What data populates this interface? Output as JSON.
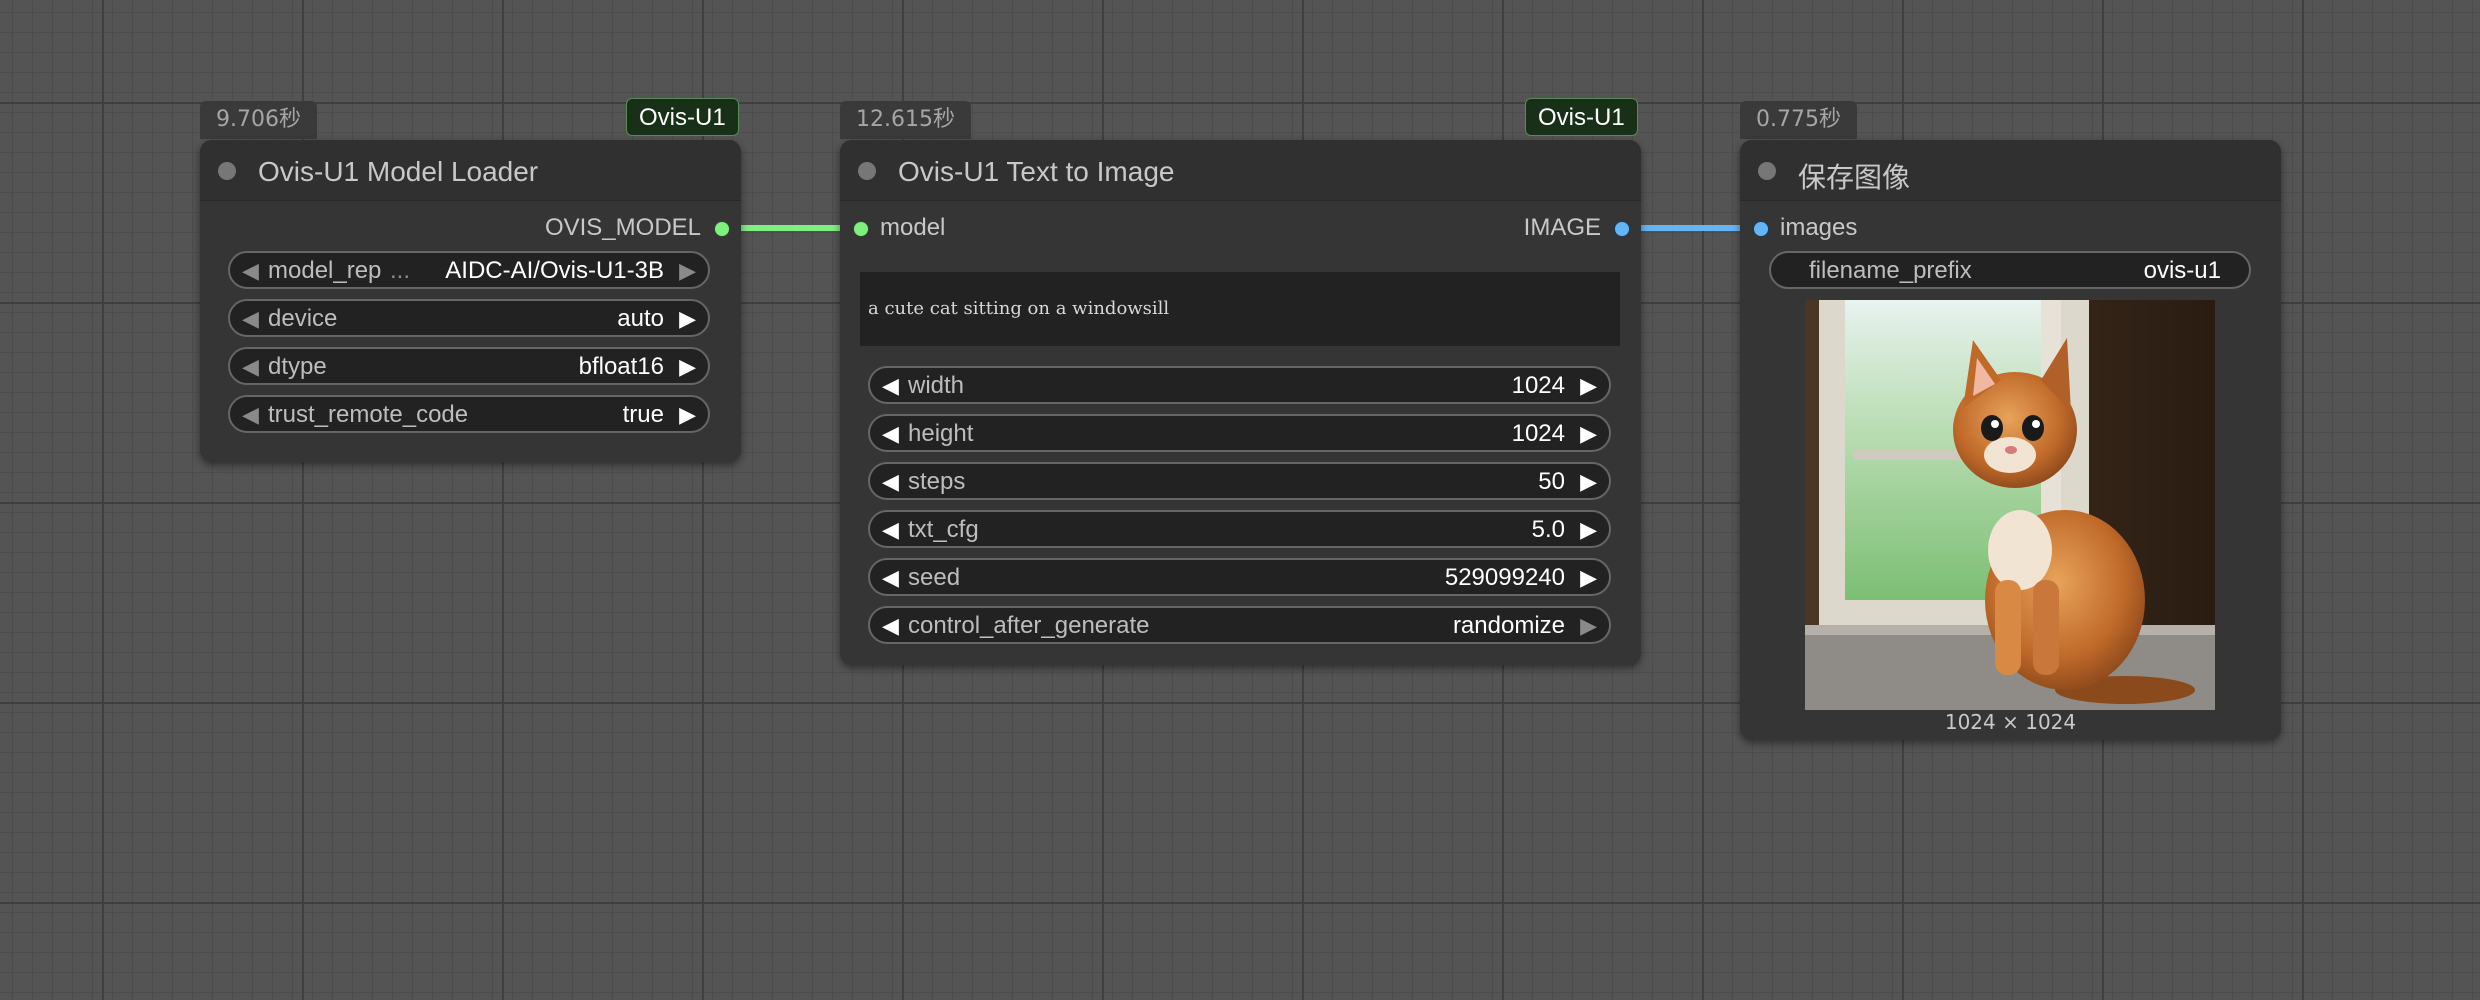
{
  "canvas": {
    "background_color": "#545454",
    "grid_color": "#3f3f3f"
  },
  "nodes": {
    "model_loader": {
      "timing": "9.706秒",
      "badge": "Ovis-U1",
      "title": "Ovis-U1 Model Loader",
      "output_label": "OVIS_MODEL",
      "output_color": "#7fef7f",
      "widgets": [
        {
          "name": "model_rep",
          "ellipsis": "...",
          "value": "AIDC-AI/Ovis-U1-3B"
        },
        {
          "name": "device",
          "value": "auto"
        },
        {
          "name": "dtype",
          "value": "bfloat16"
        },
        {
          "name": "trust_remote_code",
          "value": "true"
        }
      ]
    },
    "text_to_image": {
      "timing": "12.615秒",
      "badge": "Ovis-U1",
      "title": "Ovis-U1 Text to Image",
      "input_label": "model",
      "output_label": "IMAGE",
      "output_color": "#64b5f6",
      "prompt": "a cute cat sitting on a windowsill",
      "widgets": [
        {
          "name": "width",
          "value": "1024"
        },
        {
          "name": "height",
          "value": "1024"
        },
        {
          "name": "steps",
          "value": "50"
        },
        {
          "name": "txt_cfg",
          "value": "5.0"
        },
        {
          "name": "seed",
          "value": "529099240"
        },
        {
          "name": "control_after_generate",
          "value": "randomize"
        }
      ]
    },
    "save_image": {
      "timing": "0.775秒",
      "title": "保存图像",
      "input_label": "images",
      "widgets": [
        {
          "name": "filename_prefix",
          "value": "ovis-u1"
        }
      ],
      "image_caption": "1024 × 1024"
    }
  },
  "links": [
    {
      "from": "OVIS_MODEL",
      "to": "model",
      "color": "#7fef7f"
    },
    {
      "from": "IMAGE",
      "to": "images",
      "color": "#64b5f6"
    }
  ]
}
